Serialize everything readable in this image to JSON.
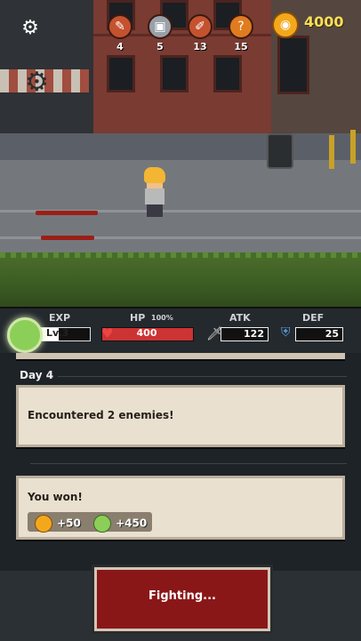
{
  "hud": {
    "settings_icon": "gear-icon",
    "resources": [
      {
        "icon": "sword-icon",
        "count": "4"
      },
      {
        "icon": "chest-icon",
        "count": "5"
      },
      {
        "icon": "bandage-icon",
        "count": "13"
      },
      {
        "icon": "mystery-icon",
        "count": "15"
      }
    ],
    "gold": "4000"
  },
  "stats": {
    "exp_label": "EXP",
    "level": "Lv.3",
    "exp_fraction": 0.45,
    "hp_label": "HP",
    "hp_percent_label": "100%",
    "hp": "400",
    "atk_label": "ATK",
    "atk": "122",
    "def_label": "DEF",
    "def": "25"
  },
  "log": {
    "day_label": "Day 4",
    "encounter_text": "Encountered 2 enemies!",
    "win_text": "You won!",
    "rewards": [
      {
        "icon": "gold-coin-icon",
        "amount": "+50",
        "color": "#f3a81c"
      },
      {
        "icon": "exp-orb-icon",
        "amount": "+450",
        "color": "#8ccf58"
      }
    ]
  },
  "action": {
    "fight_label": "Fighting..."
  },
  "colors": {
    "gold": "#f7df5c",
    "hp": "#cc3333",
    "button": "#8a1718"
  }
}
